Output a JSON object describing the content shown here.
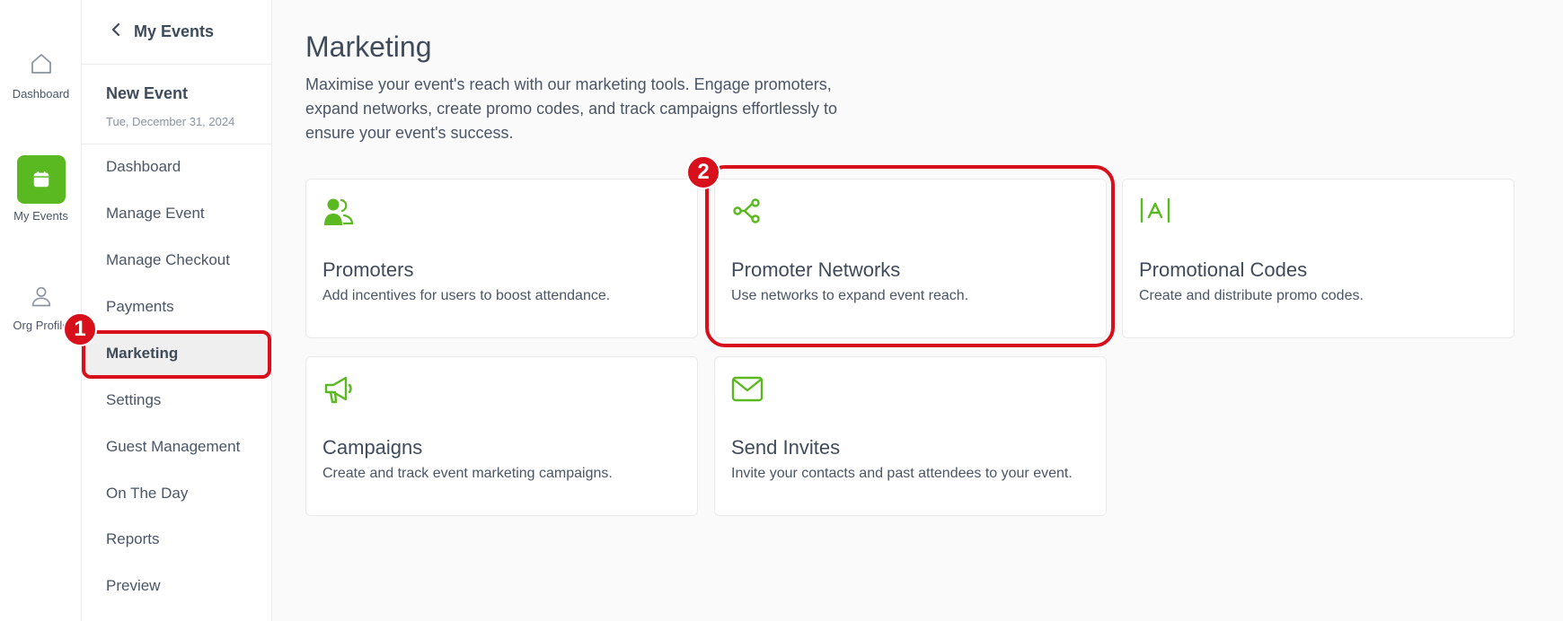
{
  "rail": {
    "items": [
      {
        "label": "Dashboard",
        "icon": "home-icon"
      },
      {
        "label": "My Events",
        "icon": "calendar-icon"
      },
      {
        "label": "Org Profile",
        "icon": "user-icon"
      }
    ]
  },
  "sidebar": {
    "back_label": "My Events",
    "event_name": "New Event",
    "event_date": "Tue, December 31, 2024",
    "items": [
      {
        "label": "Dashboard"
      },
      {
        "label": "Manage Event"
      },
      {
        "label": "Manage Checkout"
      },
      {
        "label": "Payments"
      },
      {
        "label": "Marketing"
      },
      {
        "label": "Settings"
      },
      {
        "label": "Guest Management"
      },
      {
        "label": "On The Day"
      },
      {
        "label": "Reports"
      },
      {
        "label": "Preview"
      }
    ],
    "active_item": "Marketing"
  },
  "main": {
    "title": "Marketing",
    "description": "Maximise your event's reach with our marketing tools. Engage promoters, expand networks, create promo codes, and track campaigns effortlessly to ensure your event's success.",
    "cards": [
      {
        "title": "Promoters",
        "desc": "Add incentives for users to boost attendance.",
        "icon": "promoters-icon"
      },
      {
        "title": "Promoter Networks",
        "desc": "Use networks to expand event reach.",
        "icon": "network-share-icon"
      },
      {
        "title": "Promotional Codes",
        "desc": "Create and distribute promo codes.",
        "icon": "promo-code-icon"
      },
      {
        "title": "Campaigns",
        "desc": "Create and track event marketing campaigns.",
        "icon": "megaphone-icon"
      },
      {
        "title": "Send Invites",
        "desc": "Invite your contacts and past attendees to your event.",
        "icon": "envelope-icon"
      }
    ]
  },
  "annotations": {
    "step1": "1",
    "step2": "2"
  },
  "colors": {
    "accent_green": "#5ab820",
    "highlight_red": "#d8101c"
  }
}
